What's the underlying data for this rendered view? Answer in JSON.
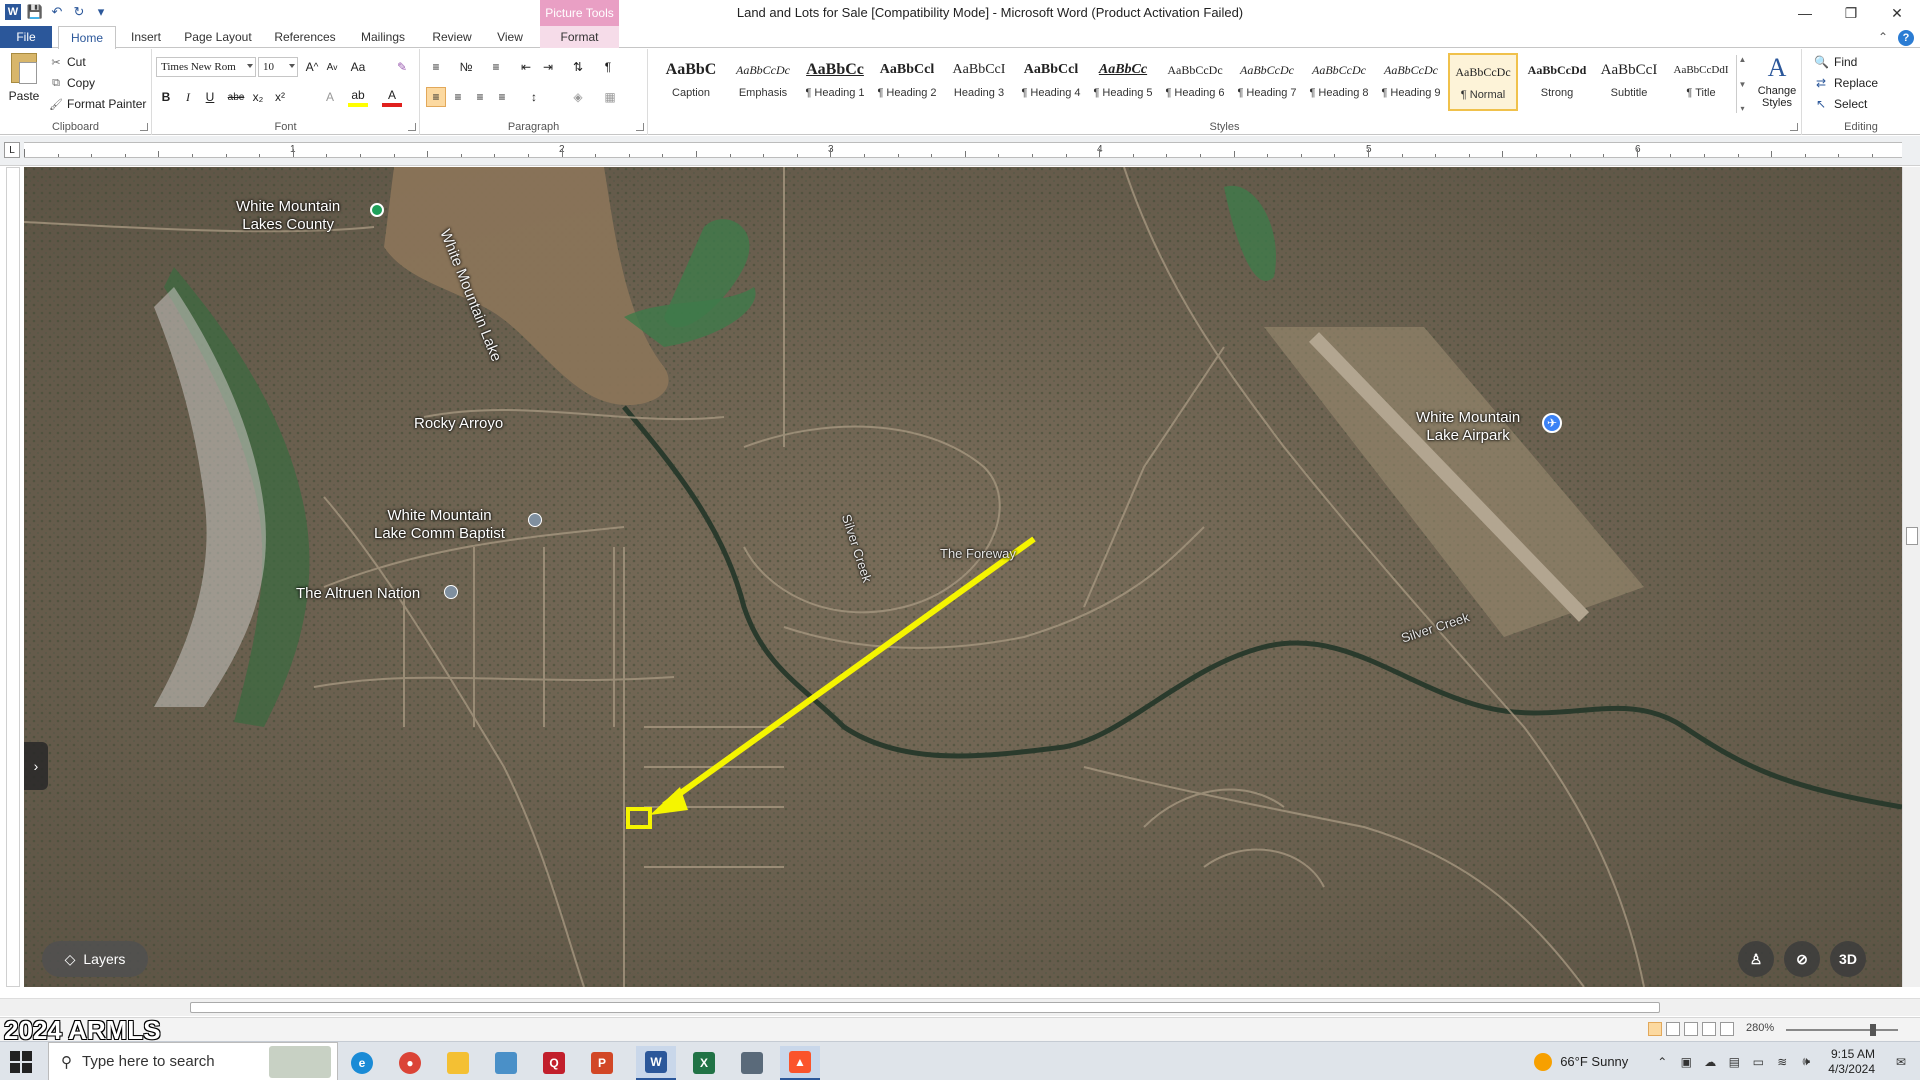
{
  "window": {
    "title": "Land and Lots for Sale [Compatibility Mode]  -  Microsoft Word (Product Activation Failed)",
    "context_tab_group": "Picture Tools"
  },
  "tabs": [
    "File",
    "Home",
    "Insert",
    "Page Layout",
    "References",
    "Mailings",
    "Review",
    "View",
    "Format"
  ],
  "ribbon": {
    "clipboard": {
      "paste": "Paste",
      "cut": "Cut",
      "copy": "Copy",
      "format_painter": "Format Painter",
      "label": "Clipboard"
    },
    "font": {
      "name": "Times New Rom",
      "size": "10",
      "label": "Font",
      "bold": "B",
      "italic": "I",
      "underline": "U",
      "strike": "abe",
      "subscript": "x₂",
      "superscript": "x²"
    },
    "paragraph": {
      "label": "Paragraph"
    },
    "styles": {
      "label": "Styles",
      "items": [
        {
          "sample": "AaBbC",
          "name": "Caption"
        },
        {
          "sample": "AaBbCcDc",
          "name": "Emphasis"
        },
        {
          "sample": "AaBbCc",
          "name": "¶ Heading 1"
        },
        {
          "sample": "AaBbCcl",
          "name": "¶ Heading 2"
        },
        {
          "sample": "AaBbCcI",
          "name": "Heading 3"
        },
        {
          "sample": "AaBbCcl",
          "name": "¶ Heading 4"
        },
        {
          "sample": "AaBbCc",
          "name": "¶ Heading 5"
        },
        {
          "sample": "AaBbCcDc",
          "name": "¶ Heading 6"
        },
        {
          "sample": "AaBbCcDc",
          "name": "¶ Heading 7"
        },
        {
          "sample": "AaBbCcDc",
          "name": "¶ Heading 8"
        },
        {
          "sample": "AaBbCcDc",
          "name": "¶ Heading 9"
        },
        {
          "sample": "AaBbCcDc",
          "name": "¶ Normal"
        },
        {
          "sample": "AaBbCcDd",
          "name": "Strong"
        },
        {
          "sample": "AaBbCcI",
          "name": "Subtitle"
        },
        {
          "sample": "AaBbCcDdI",
          "name": "¶ Title"
        }
      ],
      "change_styles": "Change Styles"
    },
    "editing": {
      "label": "Editing",
      "find": "Find",
      "replace": "Replace",
      "select": "Select"
    }
  },
  "ruler": {
    "numbers": [
      "1",
      "2",
      "3",
      "4",
      "5",
      "6"
    ]
  },
  "map": {
    "labels": {
      "lakes_county": "White Mountain\nLakes County",
      "lake": "White Mountain Lake",
      "rocky_arroyo": "Rocky Arroyo",
      "airpark": "White Mountain\nLake Airpark",
      "baptist": "White Mountain\nLake Comm Baptist",
      "altruen": "The Altruen Nation",
      "silver_creek_1": "Silver Creek",
      "silver_creek_2": "Silver Creek",
      "foreway": "The Foreway"
    },
    "layers_button": "Layers",
    "three_d_button": "3D"
  },
  "status": {
    "watermark": "2024 ARMLS",
    "zoom": "280%"
  },
  "taskbar": {
    "search_placeholder": "Type here to search",
    "weather": "66°F  Sunny",
    "time": "9:15 AM",
    "date": "4/3/2024"
  },
  "colors": {
    "word_blue": "#2b579a",
    "picture_tools": "#e99fc4",
    "annotation_arrow": "#f5f500"
  }
}
